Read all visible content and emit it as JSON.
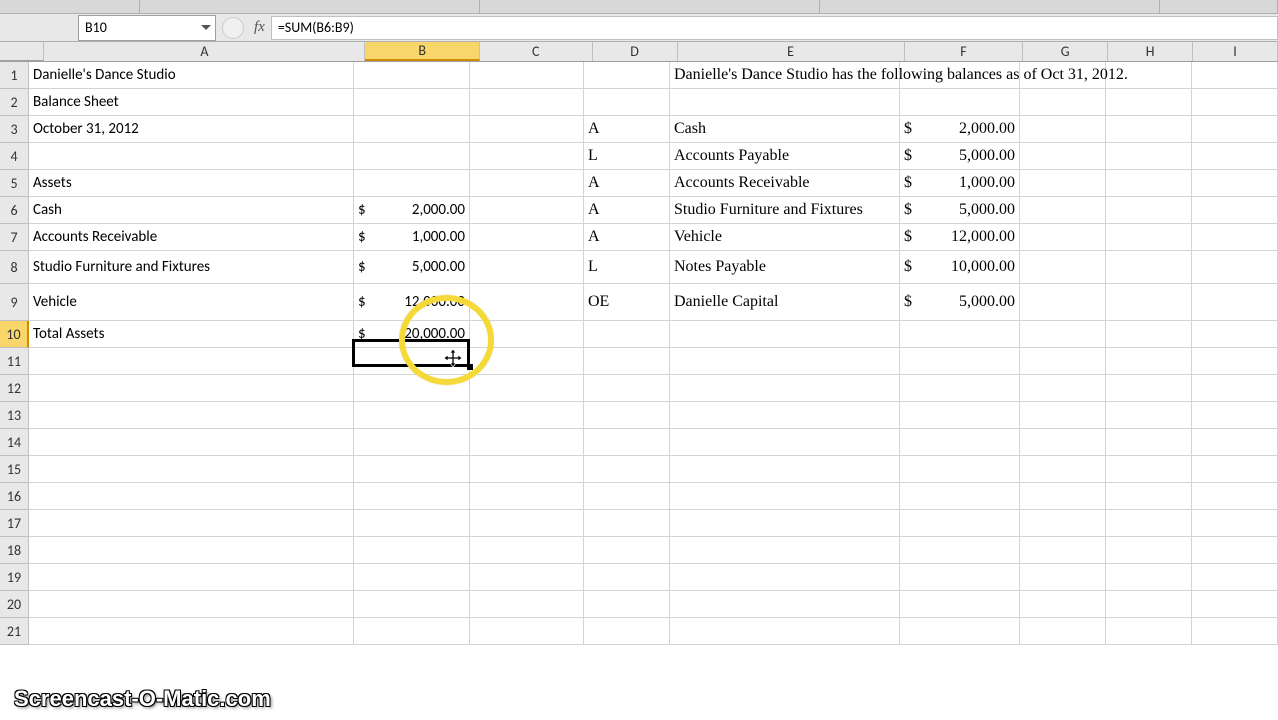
{
  "formula_bar": {
    "cell_ref": "B10",
    "fx_label": "fx",
    "formula": "=SUM(B6:B9)"
  },
  "columns": [
    "A",
    "B",
    "C",
    "D",
    "E",
    "F",
    "G",
    "H",
    "I"
  ],
  "active_col": "B",
  "active_row": "10",
  "rows": [
    "1",
    "2",
    "3",
    "4",
    "5",
    "6",
    "7",
    "8",
    "9",
    "10",
    "11",
    "12",
    "13",
    "14",
    "15",
    "16",
    "17",
    "18",
    "19",
    "20",
    "21"
  ],
  "cells": {
    "A1": "Danielle's Dance Studio",
    "A2": "Balance Sheet",
    "A3": "October 31, 2012",
    "A5": "Assets",
    "A6": "Cash",
    "A7": "Accounts Receivable",
    "A8": "Studio Furniture and Fixtures",
    "A9": "Vehicle",
    "A10": "Total Assets",
    "B6": "2,000.00",
    "B7": "1,000.00",
    "B8": "5,000.00",
    "B9": "12,000.00",
    "B10": "20,000.00",
    "D3": "A",
    "D4": "L",
    "D5": "A",
    "D6": "A",
    "D7": "A",
    "D8": "L",
    "D9": "OE",
    "E1": "Danielle's Dance Studio has the following balances as of Oct 31, 2012.",
    "E3": "Cash",
    "E4": "Accounts Payable",
    "E5": "Accounts Receivable",
    "E6": "Studio Furniture and Fixtures",
    "E7": "Vehicle",
    "E8": "Notes Payable",
    "E9": "Danielle Capital",
    "F3": "2,000.00",
    "F4": "5,000.00",
    "F5": "1,000.00",
    "F6": "5,000.00",
    "F7": "12,000.00",
    "F8": "10,000.00",
    "F9": "5,000.00"
  },
  "currency_symbol": "$",
  "watermark": "Screencast-O-Matic.com",
  "chart_data": {
    "type": "table",
    "title": "Danielle's Dance Studio Balance Sheet — October 31, 2012",
    "assets": [
      {
        "name": "Cash",
        "value": 2000.0
      },
      {
        "name": "Accounts Receivable",
        "value": 1000.0
      },
      {
        "name": "Studio Furniture and Fixtures",
        "value": 5000.0
      },
      {
        "name": "Vehicle",
        "value": 12000.0
      }
    ],
    "total_assets": 20000.0,
    "reference_balances": [
      {
        "category": "A",
        "name": "Cash",
        "value": 2000.0
      },
      {
        "category": "L",
        "name": "Accounts Payable",
        "value": 5000.0
      },
      {
        "category": "A",
        "name": "Accounts Receivable",
        "value": 1000.0
      },
      {
        "category": "A",
        "name": "Studio Furniture and Fixtures",
        "value": 5000.0
      },
      {
        "category": "A",
        "name": "Vehicle",
        "value": 12000.0
      },
      {
        "category": "L",
        "name": "Notes Payable",
        "value": 10000.0
      },
      {
        "category": "OE",
        "name": "Danielle Capital",
        "value": 5000.0
      }
    ]
  }
}
